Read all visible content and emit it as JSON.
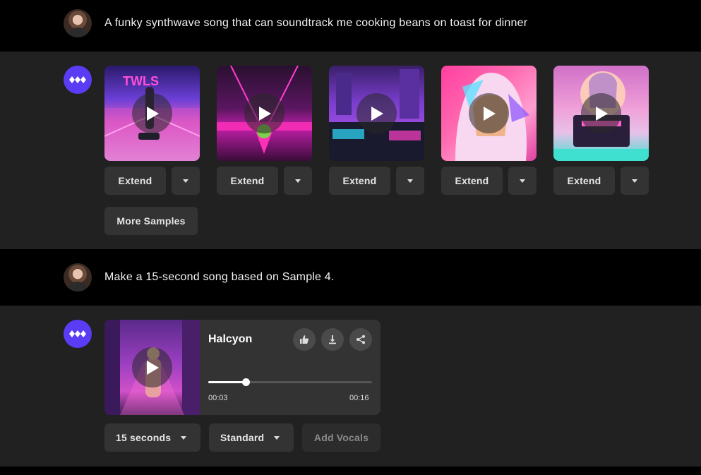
{
  "messages": {
    "user1": {
      "text": "A funky synthwave song that can soundtrack me cooking beans on toast for dinner"
    },
    "user2": {
      "text": "Make a 15-second song based on Sample 4."
    }
  },
  "samples": {
    "extend_label": "Extend",
    "more_label": "More Samples"
  },
  "player": {
    "title": "Halcyon",
    "current_time": "00:03",
    "total_time": "00:16",
    "progress": 0.23
  },
  "controls": {
    "duration_label": "15 seconds",
    "mode_label": "Standard",
    "vocals_label": "Add Vocals"
  },
  "colors": {
    "accent": "#5b3cf5",
    "user_bg": "#000000",
    "bot_bg": "#212121",
    "button_bg": "#333333"
  },
  "icons": [
    "avatar",
    "logo-icon",
    "play-icon",
    "caret-down-icon",
    "thumbs-up-icon",
    "download-icon",
    "share-icon"
  ]
}
